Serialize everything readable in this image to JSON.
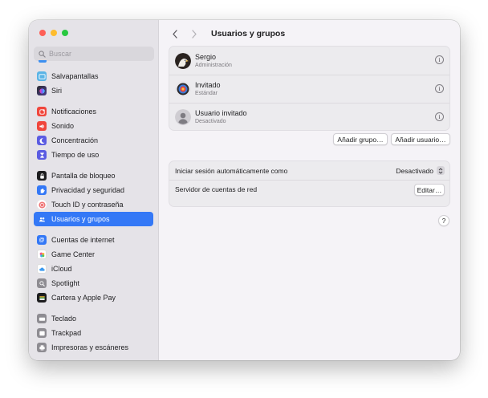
{
  "search": {
    "placeholder": "Buscar"
  },
  "sidebar": {
    "items": [
      {
        "label": "Salvapantallas",
        "icon": "screensaver-icon",
        "color": "#5ab4e6"
      },
      {
        "label": "Siri",
        "icon": "siri-icon",
        "color": "#2b2b2f"
      },
      {
        "label": "Notificaciones",
        "icon": "notifications-icon",
        "color": "#f0463c"
      },
      {
        "label": "Sonido",
        "icon": "sound-icon",
        "color": "#f0463c"
      },
      {
        "label": "Concentración",
        "icon": "focus-moon-icon",
        "color": "#5b5ce2"
      },
      {
        "label": "Tiempo de uso",
        "icon": "hourglass-icon",
        "color": "#5b5ce2"
      },
      {
        "label": "Pantalla de bloqueo",
        "icon": "lock-screen-icon",
        "color": "#1d1d1f"
      },
      {
        "label": "Privacidad y seguridad",
        "icon": "hand-icon",
        "color": "#3478f6"
      },
      {
        "label": "Touch ID y contraseña",
        "icon": "fingerprint-icon",
        "color": "#f0787a"
      },
      {
        "label": "Usuarios y grupos",
        "icon": "users-icon",
        "color": "#3478f6"
      },
      {
        "label": "Cuentas de internet",
        "icon": "at-icon",
        "color": "#3478f6"
      },
      {
        "label": "Game Center",
        "icon": "game-center-icon",
        "color": "#ffffff"
      },
      {
        "label": "iCloud",
        "icon": "cloud-icon",
        "color": "#ffffff"
      },
      {
        "label": "Spotlight",
        "icon": "magnifier-icon",
        "color": "#8e8c92"
      },
      {
        "label": "Cartera y Apple Pay",
        "icon": "wallet-icon",
        "color": "#1d1d1f"
      },
      {
        "label": "Teclado",
        "icon": "keyboard-icon",
        "color": "#8e8c92"
      },
      {
        "label": "Trackpad",
        "icon": "trackpad-icon",
        "color": "#8e8c92"
      },
      {
        "label": "Impresoras y escáneres",
        "icon": "printer-icon",
        "color": "#8e8c92"
      }
    ],
    "active_label": "Usuarios y grupos"
  },
  "header": {
    "title": "Usuarios y grupos"
  },
  "users": [
    {
      "name": "Sergio",
      "role": "Administración",
      "avatar": "eagle-avatar-icon"
    },
    {
      "name": "Invitado",
      "role": "Estándar",
      "avatar": "target-avatar-icon"
    },
    {
      "name": "Usuario invitado",
      "role": "Desactivado",
      "avatar": "person-silhouette-icon"
    }
  ],
  "buttons": {
    "add_group": "Añadir grupo…",
    "add_user": "Añadir usuario…"
  },
  "settings": {
    "auto_login_label": "Iniciar sesión automáticamente como",
    "auto_login_value": "Desactivado",
    "network_server_label": "Servidor de cuentas de red",
    "network_server_button": "Editar…"
  },
  "help": {
    "label": "?"
  },
  "colors": {
    "accent": "#3478f6"
  }
}
